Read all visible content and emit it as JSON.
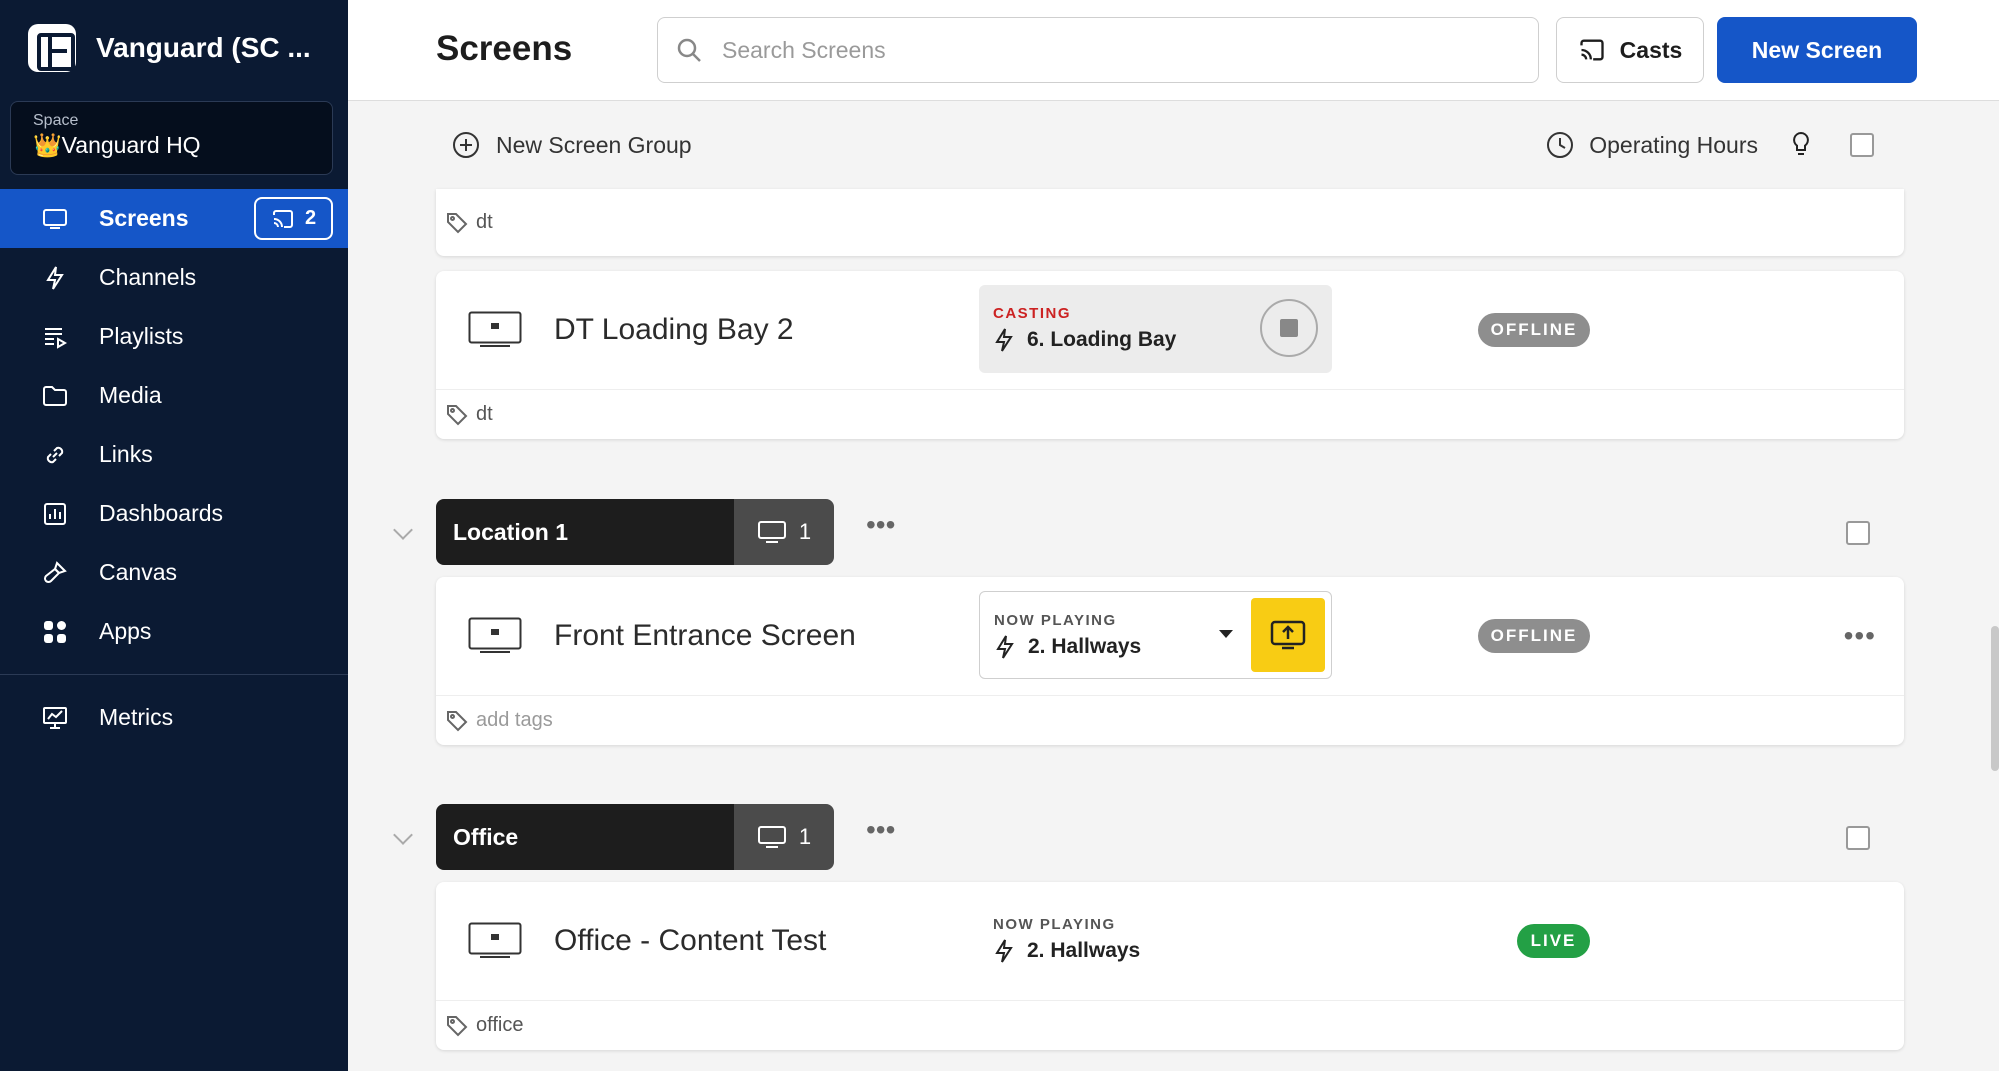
{
  "app": {
    "workspace_name": "Vanguard (SC ...",
    "space_label": "Space",
    "space_emoji": "👑",
    "space_name": "Vanguard HQ"
  },
  "sidebar": {
    "items": [
      {
        "label": "Screens",
        "icon": "monitor-icon",
        "active": true,
        "cast_count": "2"
      },
      {
        "label": "Channels",
        "icon": "bolt-icon"
      },
      {
        "label": "Playlists",
        "icon": "playlist-icon"
      },
      {
        "label": "Media",
        "icon": "folder-icon"
      },
      {
        "label": "Links",
        "icon": "link-icon"
      },
      {
        "label": "Dashboards",
        "icon": "dashboard-icon"
      },
      {
        "label": "Canvas",
        "icon": "brush-icon"
      },
      {
        "label": "Apps",
        "icon": "apps-icon"
      }
    ],
    "metrics": {
      "label": "Metrics",
      "icon": "metrics-icon"
    }
  },
  "header": {
    "title": "Screens",
    "search_placeholder": "Search Screens",
    "casts_label": "Casts",
    "new_screen_label": "New Screen"
  },
  "top_group": {
    "new_group_label": "New Screen Group",
    "operating_hours_label": "Operating Hours",
    "tag": "dt"
  },
  "screens": {
    "dt_loading": {
      "name": "DT Loading Bay 2",
      "mode_label": "CASTING",
      "channel": "6. Loading Bay",
      "status": "OFFLINE",
      "tag": "dt"
    },
    "front_entrance": {
      "name": "Front Entrance Screen",
      "mode_label": "NOW PLAYING",
      "channel": "2. Hallways",
      "status": "OFFLINE",
      "tag": "add tags"
    },
    "office_test": {
      "name": "Office - Content Test",
      "mode_label": "NOW PLAYING",
      "channel": "2. Hallways",
      "status": "LIVE",
      "tag": "office"
    }
  },
  "groups": {
    "location1": {
      "name": "Location 1",
      "count": "1"
    },
    "office": {
      "name": "Office",
      "count": "1"
    }
  },
  "colors": {
    "sidebar_bg": "#0b1a33",
    "accent": "#1556c8",
    "offline": "#8e8e8e",
    "live": "#23a045",
    "cast_button": "#f8cc14",
    "casting_red": "#cc2222"
  }
}
